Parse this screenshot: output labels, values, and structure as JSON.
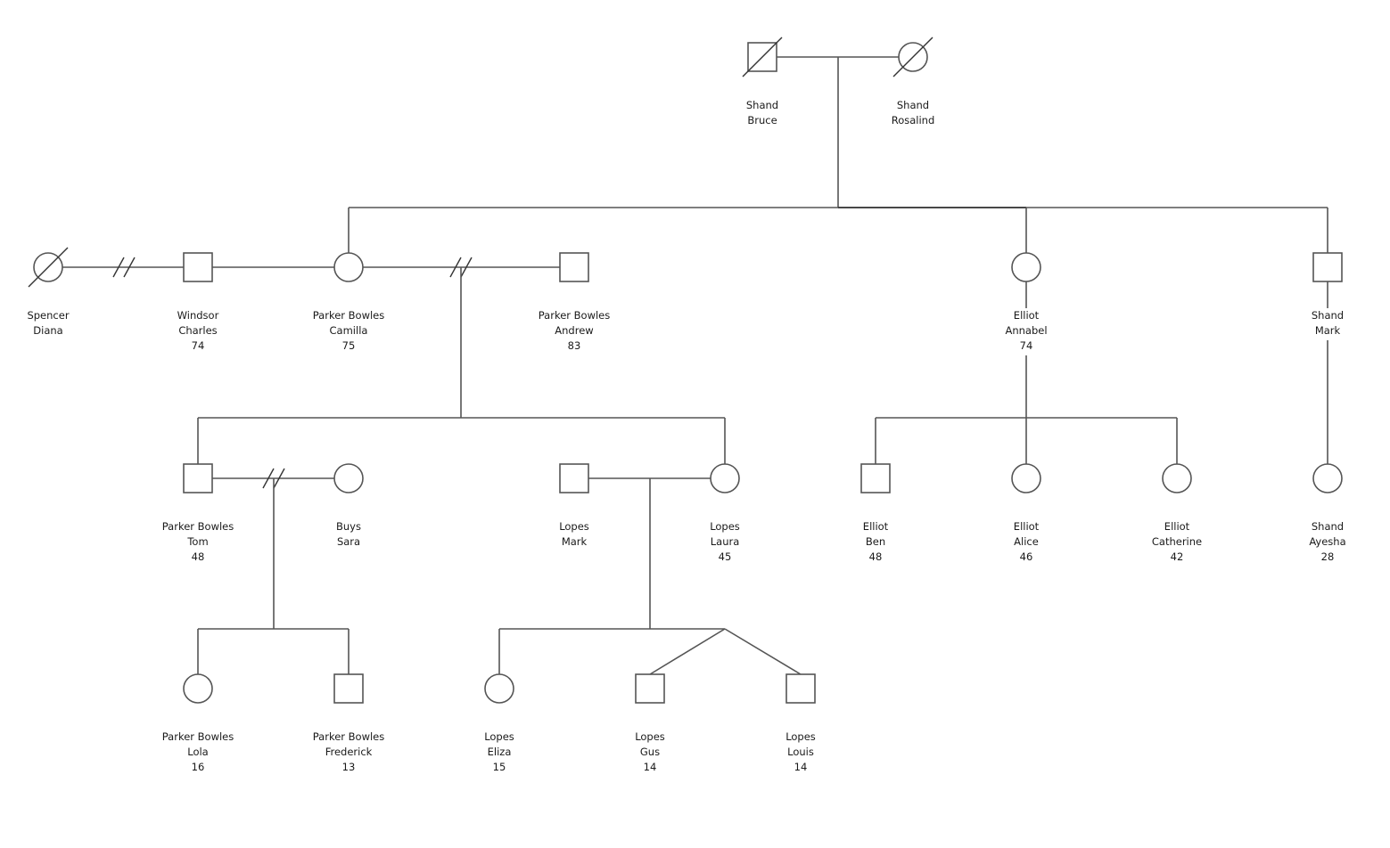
{
  "diagram": {
    "type": "genogram",
    "people": [
      {
        "id": "bruce",
        "surname": "Shand",
        "given": "Bruce",
        "age": "",
        "sex": "male",
        "deceased": true
      },
      {
        "id": "rosalind",
        "surname": "Shand",
        "given": "Rosalind",
        "age": "",
        "sex": "female",
        "deceased": true
      },
      {
        "id": "diana",
        "surname": "Spencer",
        "given": "Diana",
        "age": "",
        "sex": "female",
        "deceased": true
      },
      {
        "id": "charles",
        "surname": "Windsor",
        "given": "Charles",
        "age": "74",
        "sex": "male",
        "deceased": false
      },
      {
        "id": "camilla",
        "surname": "Parker Bowles",
        "given": "Camilla",
        "age": "75",
        "sex": "female",
        "deceased": false
      },
      {
        "id": "andrew",
        "surname": "Parker Bowles",
        "given": "Andrew",
        "age": "83",
        "sex": "male",
        "deceased": false
      },
      {
        "id": "annabel",
        "surname": "Elliot",
        "given": "Annabel",
        "age": "74",
        "sex": "female",
        "deceased": false
      },
      {
        "id": "mark_shand",
        "surname": "Shand",
        "given": "Mark",
        "age": "",
        "sex": "male",
        "deceased": false
      },
      {
        "id": "tom",
        "surname": "Parker Bowles",
        "given": "Tom",
        "age": "48",
        "sex": "male",
        "deceased": false
      },
      {
        "id": "sara",
        "surname": "Buys",
        "given": "Sara",
        "age": "",
        "sex": "female",
        "deceased": false
      },
      {
        "id": "mark_lopes",
        "surname": "Lopes",
        "given": "Mark",
        "age": "",
        "sex": "male",
        "deceased": false
      },
      {
        "id": "laura",
        "surname": "Lopes",
        "given": "Laura",
        "age": "45",
        "sex": "female",
        "deceased": false
      },
      {
        "id": "ben",
        "surname": "Elliot",
        "given": "Ben",
        "age": "48",
        "sex": "male",
        "deceased": false
      },
      {
        "id": "alice",
        "surname": "Elliot",
        "given": "Alice",
        "age": "46",
        "sex": "female",
        "deceased": false
      },
      {
        "id": "catherine",
        "surname": "Elliot",
        "given": "Catherine",
        "age": "42",
        "sex": "female",
        "deceased": false
      },
      {
        "id": "ayesha",
        "surname": "Shand",
        "given": "Ayesha",
        "age": "28",
        "sex": "female",
        "deceased": false
      },
      {
        "id": "lola",
        "surname": "Parker Bowles",
        "given": "Lola",
        "age": "16",
        "sex": "female",
        "deceased": false
      },
      {
        "id": "frederick",
        "surname": "Parker Bowles",
        "given": "Frederick",
        "age": "13",
        "sex": "male",
        "deceased": false
      },
      {
        "id": "eliza",
        "surname": "Lopes",
        "given": "Eliza",
        "age": "15",
        "sex": "female",
        "deceased": false
      },
      {
        "id": "gus",
        "surname": "Lopes",
        "given": "Gus",
        "age": "14",
        "sex": "male",
        "deceased": false
      },
      {
        "id": "louis",
        "surname": "Lopes",
        "given": "Louis",
        "age": "14",
        "sex": "male",
        "deceased": false
      }
    ],
    "relationships": [
      {
        "type": "marriage",
        "partners": [
          "bruce",
          "rosalind"
        ],
        "children": [
          "camilla",
          "annabel",
          "mark_shand"
        ]
      },
      {
        "type": "divorce",
        "partners": [
          "diana",
          "charles"
        ],
        "children": []
      },
      {
        "type": "marriage",
        "partners": [
          "charles",
          "camilla"
        ],
        "children": []
      },
      {
        "type": "divorce",
        "partners": [
          "camilla",
          "andrew"
        ],
        "children": [
          "tom",
          "laura"
        ]
      },
      {
        "type": "divorce",
        "partners": [
          "tom",
          "sara"
        ],
        "children": [
          "lola",
          "frederick"
        ]
      },
      {
        "type": "marriage",
        "partners": [
          "mark_lopes",
          "laura"
        ],
        "children": [
          "eliza",
          "gus",
          "louis"
        ],
        "twins": [
          "gus",
          "louis"
        ]
      },
      {
        "type": "single-parent",
        "partners": [
          "annabel"
        ],
        "children": [
          "ben",
          "alice",
          "catherine"
        ]
      },
      {
        "type": "single-parent",
        "partners": [
          "mark_shand"
        ],
        "children": [
          "ayesha"
        ]
      }
    ]
  }
}
